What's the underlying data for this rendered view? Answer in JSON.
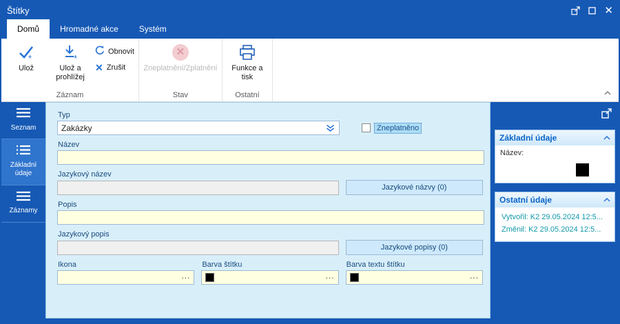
{
  "window": {
    "title": "Štítky"
  },
  "tabs": [
    {
      "label": "Domů",
      "active": true
    },
    {
      "label": "Hromadné akce",
      "active": false
    },
    {
      "label": "Systém",
      "active": false
    }
  ],
  "ribbon": {
    "groups": [
      {
        "label": "Záznam",
        "buttons": [
          {
            "label": "Ulož"
          },
          {
            "label": "Ulož a prohlížej"
          },
          {
            "label": "Obnovit"
          },
          {
            "label": "Zrušit"
          }
        ]
      },
      {
        "label": "Stav",
        "buttons": [
          {
            "label": "Zneplatnění/Zplatnění",
            "disabled": true
          }
        ]
      },
      {
        "label": "Ostatní",
        "buttons": [
          {
            "label": "Funkce a tisk"
          }
        ]
      }
    ]
  },
  "sidebar": {
    "items": [
      {
        "label": "Seznam",
        "active": false
      },
      {
        "label": "Základní údaje",
        "active": true
      },
      {
        "label": "Záznamy",
        "active": false
      }
    ]
  },
  "form": {
    "typ": {
      "label": "Typ",
      "value": "Zakázky"
    },
    "zneplatneno": {
      "label": "Zneplatněno",
      "checked": false
    },
    "nazev": {
      "label": "Název",
      "value": ""
    },
    "jazykovy_nazev": {
      "label": "Jazykový název",
      "value": "",
      "button": "Jazykové názvy (0)"
    },
    "popis": {
      "label": "Popis",
      "value": ""
    },
    "jazykovy_popis": {
      "label": "Jazykový popis",
      "value": "",
      "button": "Jazykové popisy (0)"
    },
    "ikona": {
      "label": "Ikona",
      "ellipsis": "..."
    },
    "barva_stitku": {
      "label": "Barva štítku",
      "color": "#000000",
      "ellipsis": "..."
    },
    "barva_textu_stitku": {
      "label": "Barva textu štítku",
      "color": "#000000",
      "ellipsis": "..."
    }
  },
  "side_panel": {
    "zakladni_udaje": {
      "title": "Základní údaje",
      "nazev_label": "Název:",
      "nazev_color": "#000000"
    },
    "ostatni_udaje": {
      "title": "Ostatní údaje",
      "vytvoril": "Vytvořil: K2 29.05.2024 12:5...",
      "zmenil": "Změnil: K2 29.05.2024 12:5..."
    }
  },
  "colors": {
    "titlebar_blue": "#1659b5",
    "form_background": "#d8effa",
    "input_yellow": "#ffffe1",
    "accent_blue": "#2a74d4",
    "meta_teal": "#0f98a8"
  }
}
